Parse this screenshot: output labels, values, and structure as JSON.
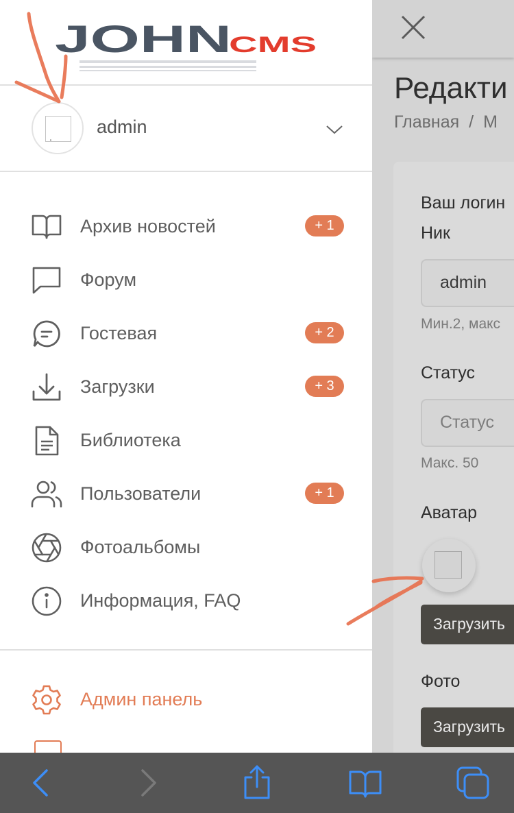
{
  "logo": {
    "main_text": "JOHN",
    "sub_text": "CMS",
    "main_color": "#4a5563",
    "sub_color": "#e33c2d"
  },
  "user": {
    "name": "admin",
    "avatar_placeholder": "."
  },
  "menu": [
    {
      "label": "Архив новостей",
      "icon": "book-icon",
      "badge": "+ 1"
    },
    {
      "label": "Форум",
      "icon": "chat-bubble-icon",
      "badge": ""
    },
    {
      "label": "Гостевая",
      "icon": "guestbook-chat-icon",
      "badge": "+ 2"
    },
    {
      "label": "Загрузки",
      "icon": "download-icon",
      "badge": "+ 3"
    },
    {
      "label": "Библиотека",
      "icon": "document-icon",
      "badge": ""
    },
    {
      "label": "Пользователи",
      "icon": "users-icon",
      "badge": "+ 1"
    },
    {
      "label": "Фотоальбомы",
      "icon": "aperture-icon",
      "badge": ""
    },
    {
      "label": "Информация, FAQ",
      "icon": "info-icon",
      "badge": ""
    }
  ],
  "admin": {
    "label": "Админ панель",
    "icon": "gear-icon"
  },
  "page": {
    "title": "Редакти",
    "breadcrumb": {
      "home": "Главная",
      "sep": "/",
      "next": "М"
    },
    "login_label": "Ваш логин",
    "nick_label": "Ник",
    "nick_value": "admin",
    "nick_hint": "Мин.2, макс",
    "status_label": "Статус",
    "status_placeholder": "Статус",
    "status_hint": "Макс. 50",
    "avatar_label": "Аватар",
    "upload_avatar": "Загрузить",
    "photo_label": "Фото",
    "upload_photo": "Загрузить"
  },
  "colors": {
    "accent": "#e27c55",
    "annotation": "#e8714f",
    "toolbar": "#555555",
    "toolbar_icon": "#3d8ef7"
  },
  "browser_bar": {
    "icons": [
      "back-icon",
      "forward-icon",
      "share-icon",
      "bookmarks-icon",
      "tabs-icon"
    ]
  }
}
